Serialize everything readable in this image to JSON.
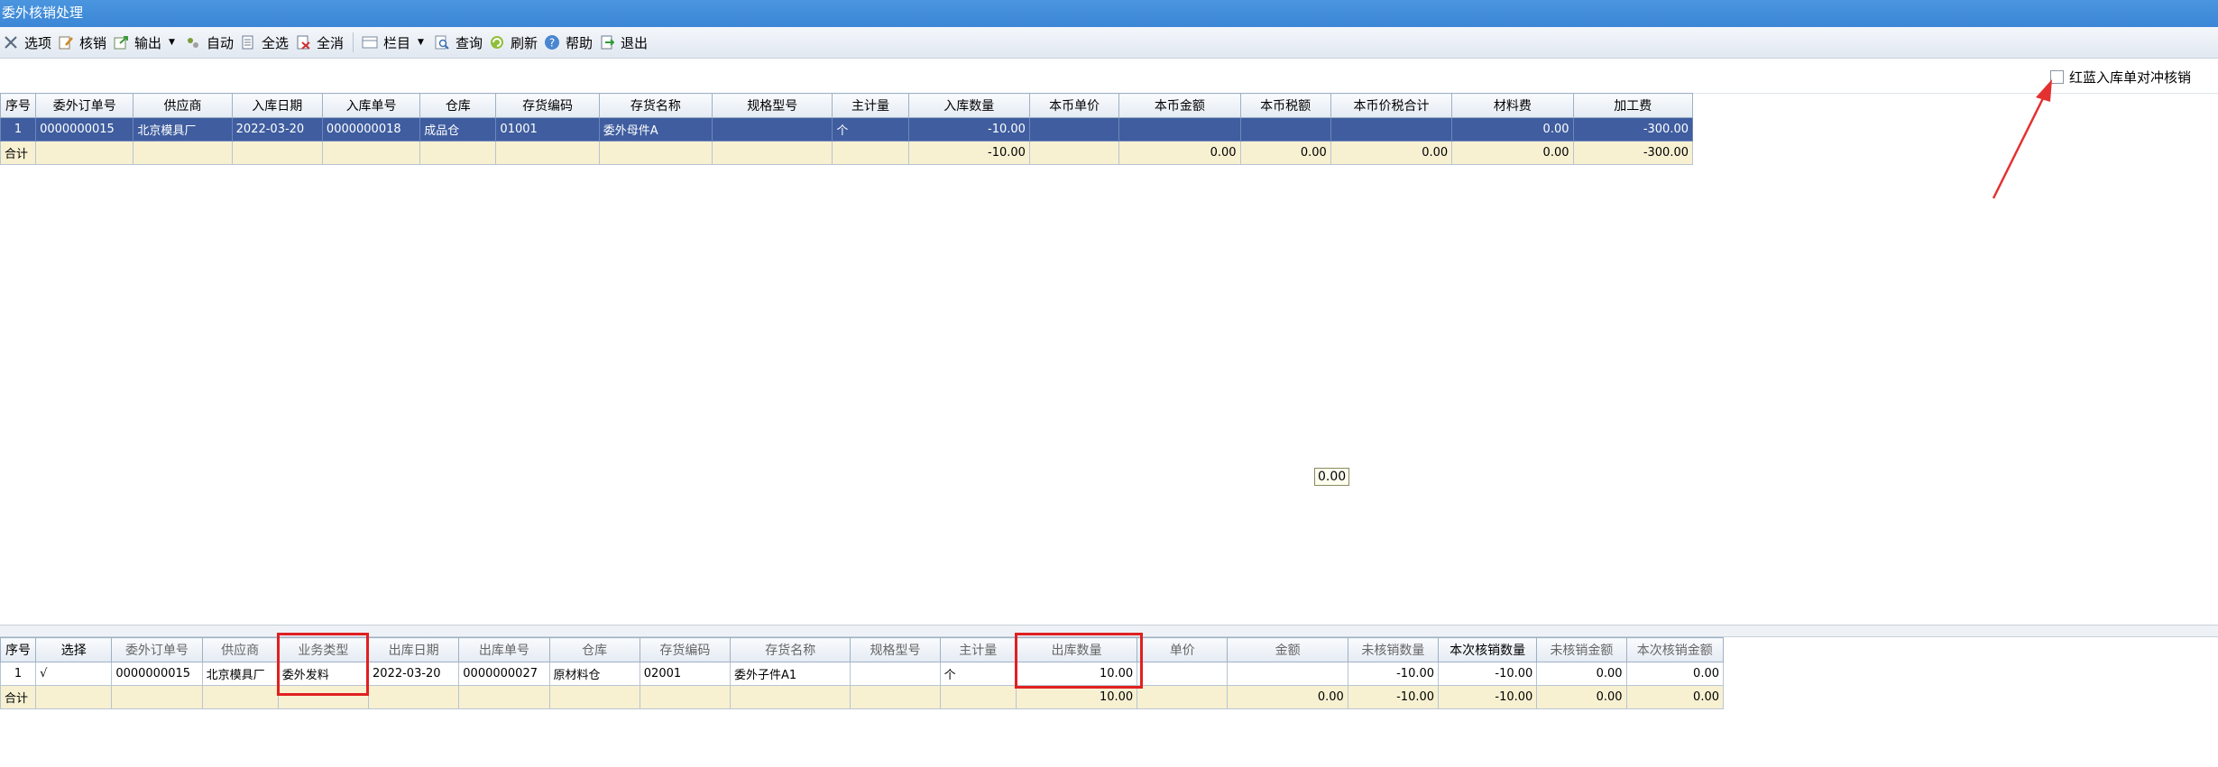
{
  "window": {
    "title": "委外核销处理"
  },
  "toolbar": {
    "options": "选项",
    "verify": "核销",
    "export": "输出",
    "auto": "自动",
    "select_all": "全选",
    "deselect_all": "全消",
    "columns": "栏目",
    "query": "查询",
    "refresh": "刷新",
    "help": "帮助",
    "exit": "退出"
  },
  "options": {
    "red_blue_label": "红蓝入库单对冲核销",
    "red_blue_checked": false
  },
  "top_grid": {
    "headers": [
      "序号",
      "委外订单号",
      "供应商",
      "入库日期",
      "入库单号",
      "仓库",
      "存货编码",
      "存货名称",
      "规格型号",
      "主计量",
      "入库数量",
      "本币单价",
      "本币金额",
      "本币税额",
      "本币价税合计",
      "材料费",
      "加工费"
    ],
    "rows": [
      [
        "1",
        "0000000015",
        "北京模具厂",
        "2022-03-20",
        "0000000018",
        "成品仓",
        "01001",
        "委外母件A",
        "",
        "个",
        "-10.00",
        "",
        "",
        "",
        "",
        "0.00",
        "-300.00"
      ]
    ],
    "total": [
      "合计",
      "",
      "",
      "",
      "",
      "",
      "",
      "",
      "",
      "",
      "-10.00",
      "",
      "0.00",
      "0.00",
      "0.00",
      "0.00",
      "-300.00"
    ]
  },
  "tooltip": "0.00",
  "bottom_grid": {
    "headers": [
      "序号",
      "选择",
      "委外订单号",
      "供应商",
      "业务类型",
      "出库日期",
      "出库单号",
      "仓库",
      "存货编码",
      "存货名称",
      "规格型号",
      "主计量",
      "出库数量",
      "单价",
      "金额",
      "未核销数量",
      "本次核销数量",
      "未核销金额",
      "本次核销金额"
    ],
    "rows": [
      [
        "1",
        "√",
        "0000000015",
        "北京模具厂",
        "委外发料",
        "2022-03-20",
        "0000000027",
        "原材料仓",
        "02001",
        "委外子件A1",
        "",
        "个",
        "10.00",
        "",
        "",
        "-10.00",
        "-10.00",
        "0.00",
        "0.00"
      ]
    ],
    "total": [
      "合计",
      "",
      "",
      "",
      "",
      "",
      "",
      "",
      "",
      "",
      "",
      "",
      "10.00",
      "",
      "0.00",
      "-10.00",
      "-10.00",
      "0.00",
      "0.00"
    ]
  }
}
